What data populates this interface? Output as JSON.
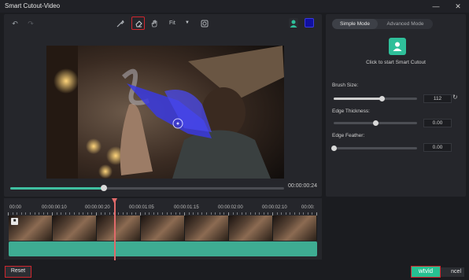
{
  "window": {
    "title": "Smart Cutout-Video",
    "controls": [
      "minimize",
      "close"
    ]
  },
  "toolbar": {
    "undo_icon": "undo-icon",
    "redo_icon": "redo-icon",
    "brush_icon": "brush-icon",
    "eraser_icon": "eraser-icon",
    "hand_icon": "hand-icon",
    "fit_value": "Fit",
    "mask_icon": "mask-icon",
    "person_swatch_color": "#2fbf9a",
    "color_swatch": "#1010a0"
  },
  "player": {
    "timecode": "00:00:00:24",
    "progress": 0.34,
    "zoom_level": 0.35
  },
  "right_panel": {
    "mode_simple": "Simple Mode",
    "mode_advanced": "Advanced Mode",
    "smart_cutout_label": "Click to start Smart Cutout",
    "brush_size_label": "Brush Size:",
    "brush_size_value": "112",
    "brush_size_level": 0.58,
    "edge_thickness_label": "Edge Thickness:",
    "edge_thickness_value": "0.00",
    "edge_thickness_level": 0.5,
    "edge_feather_label": "Edge Feather:",
    "edge_feather_value": "0.00",
    "edge_feather_level": 0.0
  },
  "timeline": {
    "ruler_labels": [
      "00:00",
      "00:00:00:10",
      "00:00:00:20",
      "00:00:01:05",
      "00:00:01:15",
      "00:00:02:00",
      "00:00:02:10",
      "00:00:"
    ],
    "thumbnail_count": 7
  },
  "footer": {
    "reset_label": "Reset",
    "ok_label": "wtvid",
    "cancel_label": "ncel"
  },
  "colors": {
    "accent": "#2fbf9a",
    "highlight_box": "#d0262e",
    "mask_blue": "#3a3ae0"
  }
}
